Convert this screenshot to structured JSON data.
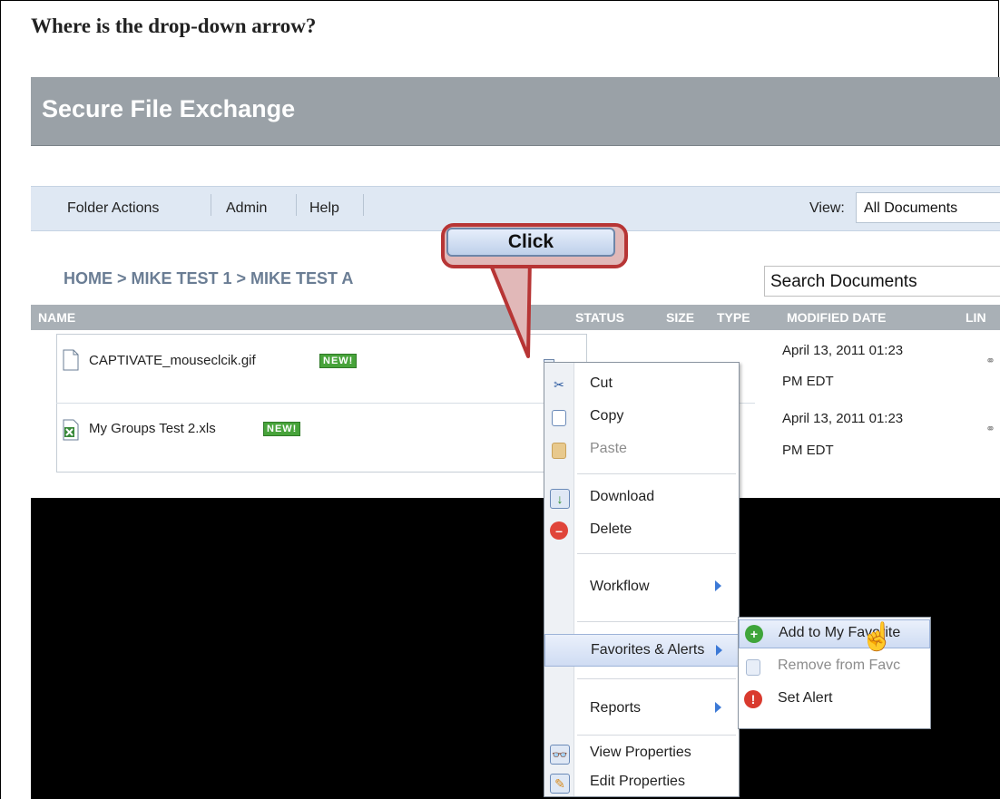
{
  "question": "Where is the drop-down arrow?",
  "app": {
    "title": "Secure File Exchange"
  },
  "toolbar": {
    "items": [
      "Folder Actions",
      "Admin",
      "Help"
    ],
    "view_label": "View:",
    "view_value": "All Documents"
  },
  "breadcrumb": "HOME > MIKE TEST 1 > MIKE TEST A",
  "search": {
    "placeholder": "Search Documents"
  },
  "columns": [
    "NAME",
    "STATUS",
    "SIZE",
    "TYPE",
    "MODIFIED DATE",
    "LIN"
  ],
  "files": [
    {
      "name": "CAPTIVATE_mouseclcik.gif",
      "badge": "NEW!",
      "date_line1": "April 13, 2011 01:23",
      "date_line2": "PM EDT"
    },
    {
      "name": "My Groups Test 2.xls",
      "badge": "NEW!",
      "date_line1": "April 13, 2011 01:23",
      "date_line2": "PM EDT"
    }
  ],
  "callout": {
    "text": "Click"
  },
  "context_menu": {
    "cut": "Cut",
    "copy": "Copy",
    "paste": "Paste",
    "download": "Download",
    "delete": "Delete",
    "workflow": "Workflow",
    "favorites": "Favorites & Alerts",
    "reports": "Reports",
    "view_properties": "View Properties",
    "edit_properties": "Edit Properties"
  },
  "submenu": {
    "add_favorite": "Add to My Favorite",
    "remove_favorite": "Remove from Favc",
    "set_alert": "Set Alert"
  }
}
